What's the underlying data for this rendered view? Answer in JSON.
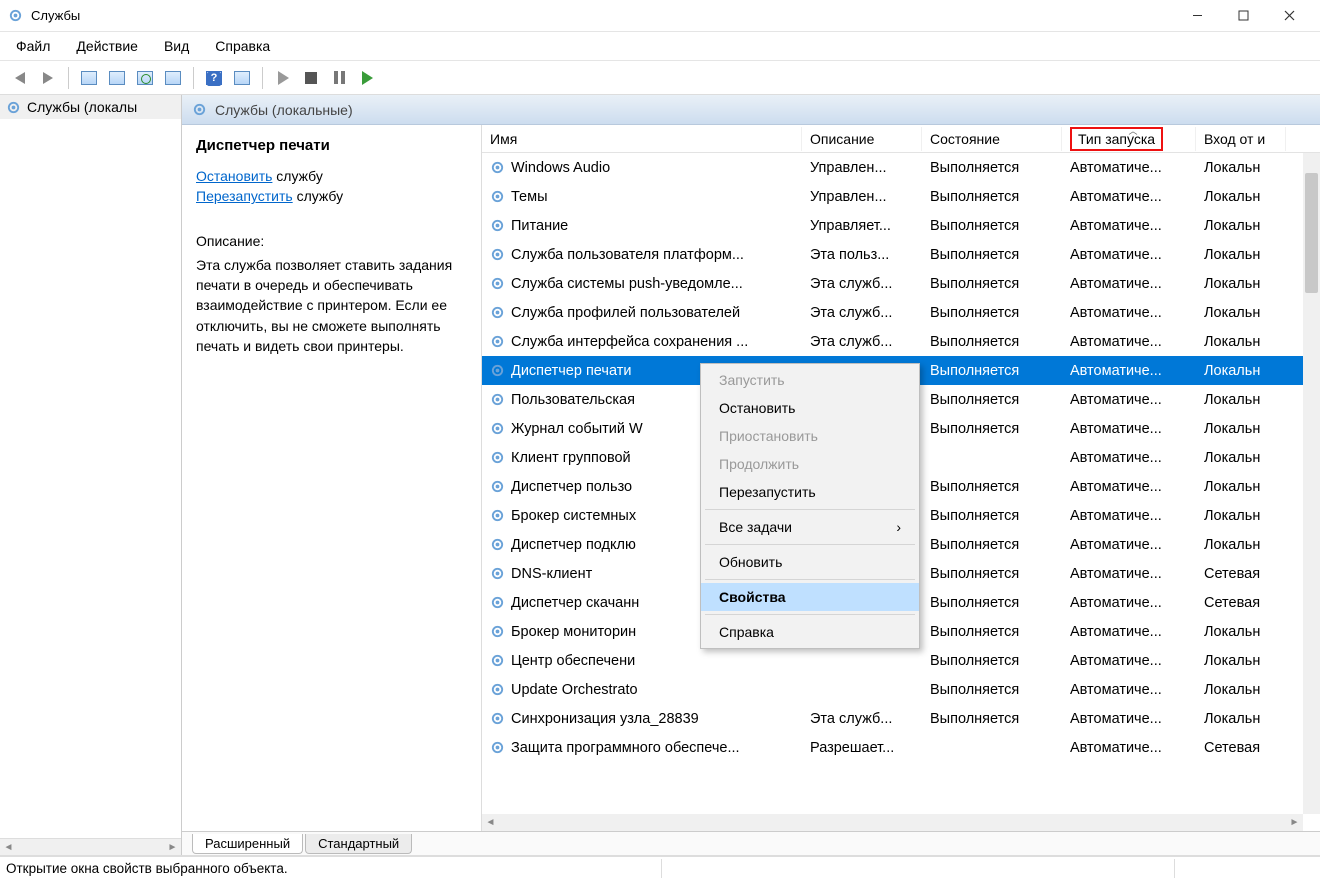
{
  "window": {
    "title": "Службы"
  },
  "menu": {
    "file": "Файл",
    "action": "Действие",
    "view": "Вид",
    "help": "Справка"
  },
  "tree": {
    "root": "Службы (локалы"
  },
  "header": {
    "title": "Службы (локальные)"
  },
  "details": {
    "title": "Диспетчер печати",
    "stop_link": "Остановить",
    "stop_suffix": " службу",
    "restart_link": "Перезапустить",
    "restart_suffix": " службу",
    "desc_label": "Описание:",
    "desc_text": "Эта служба позволяет ставить задания печати в очередь и обеспечивать взаимодействие с принтером. Если ее отключить, вы не сможете выполнять печать и видеть свои принтеры."
  },
  "columns": {
    "name": "Имя",
    "desc": "Описание",
    "state": "Состояние",
    "startup": "Тип запуска",
    "logon": "Вход от и"
  },
  "rows": [
    {
      "name": "Windows Audio",
      "desc": "Управлен...",
      "state": "Выполняется",
      "startup": "Автоматиче...",
      "logon": "Локальн"
    },
    {
      "name": "Темы",
      "desc": "Управлен...",
      "state": "Выполняется",
      "startup": "Автоматиче...",
      "logon": "Локальн"
    },
    {
      "name": "Питание",
      "desc": "Управляет...",
      "state": "Выполняется",
      "startup": "Автоматиче...",
      "logon": "Локальн"
    },
    {
      "name": "Служба пользователя платформ...",
      "desc": "Эта польз...",
      "state": "Выполняется",
      "startup": "Автоматиче...",
      "logon": "Локальн"
    },
    {
      "name": "Служба системы push-уведомле...",
      "desc": "Эта служб...",
      "state": "Выполняется",
      "startup": "Автоматиче...",
      "logon": "Локальн"
    },
    {
      "name": "Служба профилей пользователей",
      "desc": "Эта служб...",
      "state": "Выполняется",
      "startup": "Автоматиче...",
      "logon": "Локальн"
    },
    {
      "name": "Служба интерфейса сохранения ...",
      "desc": "Эта служб...",
      "state": "Выполняется",
      "startup": "Автоматиче...",
      "logon": "Локальн"
    },
    {
      "name": "Диспетчер печати",
      "desc": "",
      "state": "Выполняется",
      "startup": "Автоматиче...",
      "logon": "Локальн",
      "selected": true
    },
    {
      "name": "Пользовательская",
      "desc": "",
      "state": "Выполняется",
      "startup": "Автоматиче...",
      "logon": "Локальн"
    },
    {
      "name": "Журнал событий W",
      "desc": "",
      "state": "Выполняется",
      "startup": "Автоматиче...",
      "logon": "Локальн"
    },
    {
      "name": "Клиент групповой",
      "desc": "",
      "state": "",
      "startup": "Автоматиче...",
      "logon": "Локальн"
    },
    {
      "name": "Диспетчер пользо",
      "desc": "",
      "state": "Выполняется",
      "startup": "Автоматиче...",
      "logon": "Локальн"
    },
    {
      "name": "Брокер системных",
      "desc": "",
      "state": "Выполняется",
      "startup": "Автоматиче...",
      "logon": "Локальн"
    },
    {
      "name": "Диспетчер подклю",
      "desc": "",
      "state": "Выполняется",
      "startup": "Автоматиче...",
      "logon": "Локальн"
    },
    {
      "name": "DNS-клиент",
      "desc": "",
      "state": "Выполняется",
      "startup": "Автоматиче...",
      "logon": "Сетевая"
    },
    {
      "name": "Диспетчер скачанн",
      "desc": "",
      "state": "Выполняется",
      "startup": "Автоматиче...",
      "logon": "Сетевая"
    },
    {
      "name": "Брокер мониторин",
      "desc": "",
      "state": "Выполняется",
      "startup": "Автоматиче...",
      "logon": "Локальн"
    },
    {
      "name": "Центр обеспечени",
      "desc": "",
      "state": "Выполняется",
      "startup": "Автоматиче...",
      "logon": "Локальн"
    },
    {
      "name": "Update Orchestrato",
      "desc": "",
      "state": "Выполняется",
      "startup": "Автоматиче...",
      "logon": "Локальн"
    },
    {
      "name": "Синхронизация узла_28839",
      "desc": "Эта служб...",
      "state": "Выполняется",
      "startup": "Автоматиче...",
      "logon": "Локальн"
    },
    {
      "name": "Защита программного обеспече...",
      "desc": "Разрешает...",
      "state": "",
      "startup": "Автоматиче...",
      "logon": "Сетевая"
    }
  ],
  "context_menu": {
    "start": "Запустить",
    "stop": "Остановить",
    "pause": "Приостановить",
    "continue": "Продолжить",
    "restart": "Перезапустить",
    "all_tasks": "Все задачи",
    "refresh": "Обновить",
    "properties": "Свойства",
    "help": "Справка"
  },
  "tabs": {
    "extended": "Расширенный",
    "standard": "Стандартный"
  },
  "statusbar": {
    "text": "Открытие окна свойств выбранного объекта."
  }
}
